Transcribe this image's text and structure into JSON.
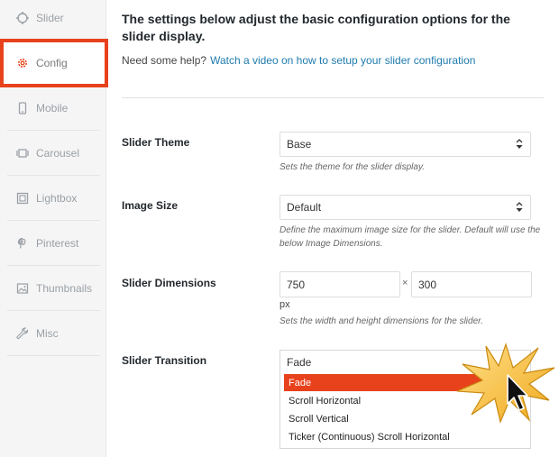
{
  "sidebar": {
    "items": [
      {
        "label": "Slider",
        "icon": "slider-icon"
      },
      {
        "label": "Config",
        "icon": "gear-icon",
        "active": true
      },
      {
        "label": "Mobile",
        "icon": "mobile-icon"
      },
      {
        "label": "Carousel",
        "icon": "carousel-icon"
      },
      {
        "label": "Lightbox",
        "icon": "lightbox-icon"
      },
      {
        "label": "Pinterest",
        "icon": "pinterest-icon"
      },
      {
        "label": "Thumbnails",
        "icon": "thumbnails-icon"
      },
      {
        "label": "Misc",
        "icon": "wrench-icon"
      }
    ],
    "accent_color": "#e8421c"
  },
  "main": {
    "intro": "The settings below adjust the basic configuration options for the slider display.",
    "help_text": "Need some help?",
    "help_link": "Watch a video on how to setup your slider configuration",
    "fields": {
      "theme": {
        "label": "Slider Theme",
        "value": "Base",
        "description": "Sets the theme for the slider display."
      },
      "image_size": {
        "label": "Image Size",
        "value": "Default",
        "description": "Define the maximum image size for the slider. Default will use the below Image Dimensions."
      },
      "dimensions": {
        "label": "Slider Dimensions",
        "width": "750",
        "separator": "×",
        "height": "300",
        "unit": "px",
        "description": "Sets the width and height dimensions for the slider."
      },
      "transition": {
        "label": "Slider Transition",
        "value": "Fade",
        "options": [
          "Fade",
          "Scroll Horizontal",
          "Scroll Vertical",
          "Ticker (Continuous) Scroll Horizontal"
        ],
        "highlighted_index": 0
      }
    }
  }
}
